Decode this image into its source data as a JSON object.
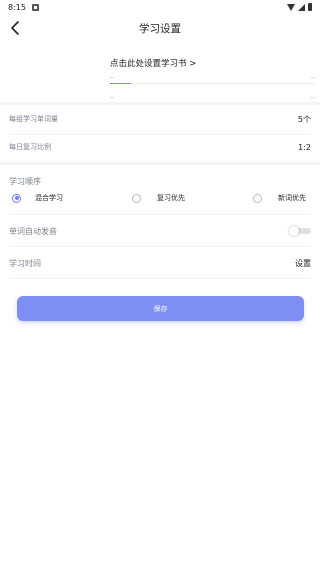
{
  "status_bar": {
    "time": "8:15"
  },
  "header": {
    "title": "学习设置"
  },
  "book": {
    "link_label": "点击此处设置学习书 >",
    "progress_left": "--",
    "progress_right": "--",
    "bottom_left": "--",
    "bottom_right": "--",
    "progress_fraction": 0.1
  },
  "settings": {
    "group_words_label": "每组学习单词量",
    "group_words_value": "5个",
    "review_ratio_label": "每日复习比例",
    "review_ratio_value": "1:2"
  },
  "order": {
    "title": "学习顺序",
    "options": [
      {
        "label": "混合学习",
        "checked": true
      },
      {
        "label": "复习优先",
        "checked": false
      },
      {
        "label": "新词优先",
        "checked": false
      }
    ]
  },
  "auto_pronounce": {
    "label": "单词自动发音",
    "enabled": false
  },
  "study_time": {
    "label": "学习时间",
    "value": "设置"
  },
  "actions": {
    "save_label": "保存"
  },
  "colors": {
    "accent": "#7e8ef2",
    "radio": "#6d7ff0",
    "divider": "#f4f5f8"
  }
}
